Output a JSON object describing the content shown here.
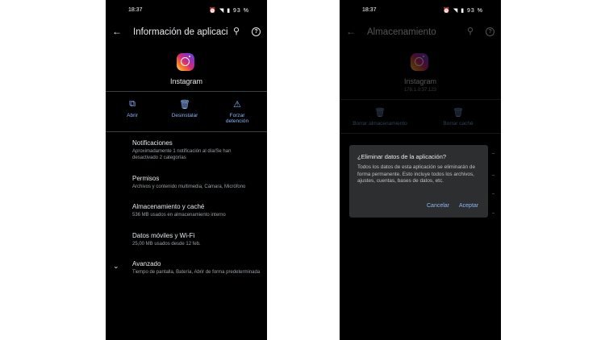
{
  "left_screen": {
    "status": {
      "time": "18:37",
      "icons": "⏰ ◥ ▮ 93 %"
    },
    "appbar": {
      "title": "Información de aplicaciones"
    },
    "app": {
      "name": "Instagram"
    },
    "actions": [
      {
        "label": "Abrir",
        "icon": "open-icon"
      },
      {
        "label": "Desinstalar",
        "icon": "trash-icon"
      },
      {
        "label_line1": "Forzar",
        "label_line2": "detención",
        "icon": "warning-icon"
      }
    ],
    "items": [
      {
        "title": "Notificaciones",
        "subtitle_line1": "Aproximadamente 1 notificación al día/Se han",
        "subtitle_line2": "desactivado 2 categorías"
      },
      {
        "title": "Permisos",
        "subtitle_line1": "Archivos y contenido multimedia, Cámara, Micrófono"
      },
      {
        "title": "Almacenamiento y caché",
        "subtitle_line1": "536 MB usados en almacenamiento interno"
      },
      {
        "title": "Datos móviles y Wi-Fi",
        "subtitle_line1": "25,00 MB usados desde 12 feb."
      },
      {
        "title": "Avanzado",
        "subtitle_line1": "Tiempo de pantalla, Batería, Abrir de forma predeterminada"
      }
    ]
  },
  "right_screen": {
    "status": {
      "time": "18:37",
      "icons": "⏰ ◥ ▮ 93 %"
    },
    "appbar": {
      "title": "Almacenamiento"
    },
    "app": {
      "name": "Instagram",
      "version": "178.1.0.37.123"
    },
    "actions": [
      {
        "label": "Borrar almacenamiento",
        "icon": "trash-icon"
      },
      {
        "label": "Borrar caché",
        "icon": "trash-icon"
      }
    ],
    "dialog": {
      "title": "¿Eliminar datos de la aplicación?",
      "body": "Todos los datos de esta aplicación se eliminarán de forma permanente. Esto incluye todos los archivos, ajustes, cuentas, bases de datos, etc.",
      "cancel": "Cancelar",
      "accept": "Aceptar"
    }
  },
  "colors": {
    "accent": "#8ab4f8",
    "background": "#000000",
    "dialog": "#2d2e30"
  }
}
